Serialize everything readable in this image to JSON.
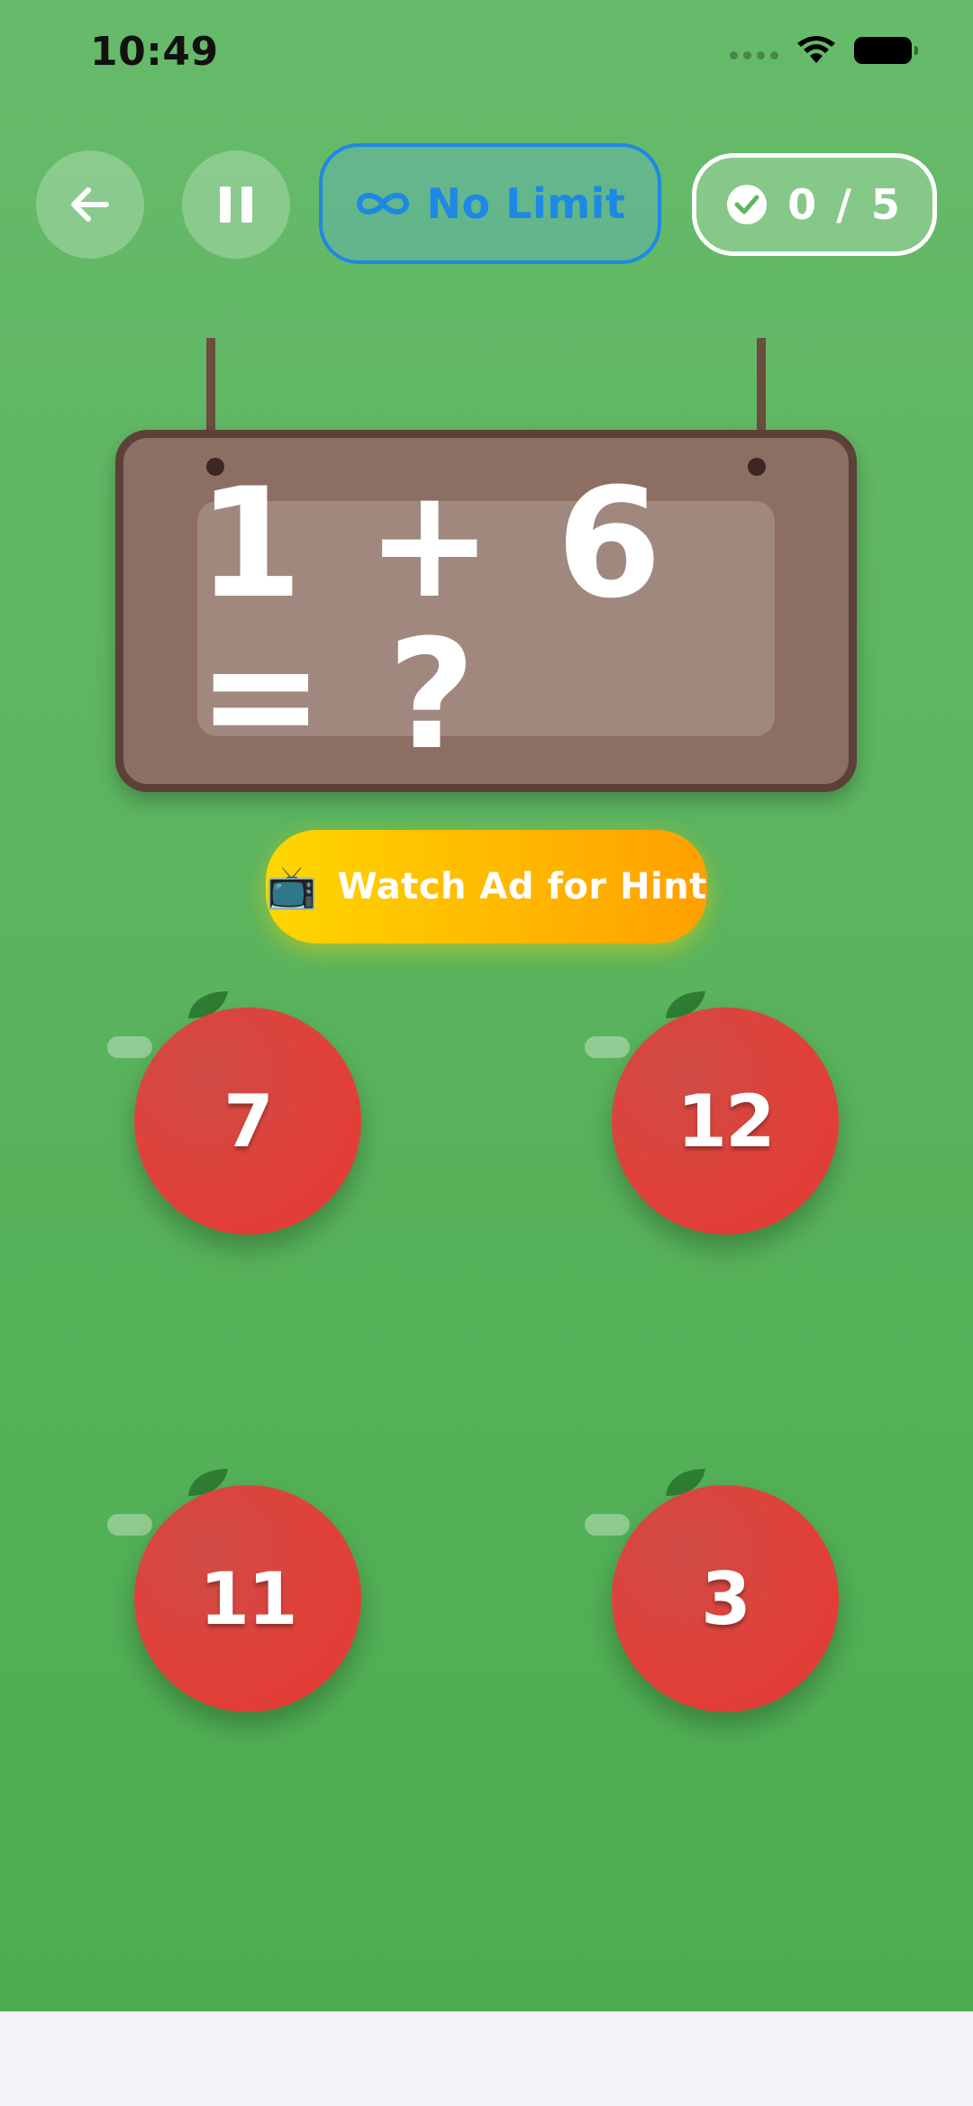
{
  "status_bar": {
    "time": "10:49"
  },
  "controls": {
    "back_icon": "arrow-left-icon",
    "pause_icon": "pause-icon",
    "limit": {
      "icon": "infinity-icon",
      "label": "No Limit",
      "color": "#1e88e5"
    },
    "score": {
      "icon": "check-circle-icon",
      "text": "0 / 5"
    }
  },
  "question": {
    "equation": "1 + 6 = ?"
  },
  "hint_button": {
    "icon": "television-emoji",
    "emoji": "📺",
    "label": "Watch Ad for Hint"
  },
  "answers": [
    {
      "value": "7"
    },
    {
      "value": "12"
    },
    {
      "value": "11"
    },
    {
      "value": "3"
    }
  ],
  "colors": {
    "background": "#5cb85f",
    "apple": "#e53935",
    "board": "#8d6e63",
    "board_border": "#5d4037",
    "hint_gradient_start": "#ffd600",
    "hint_gradient_end": "#ffa000"
  }
}
